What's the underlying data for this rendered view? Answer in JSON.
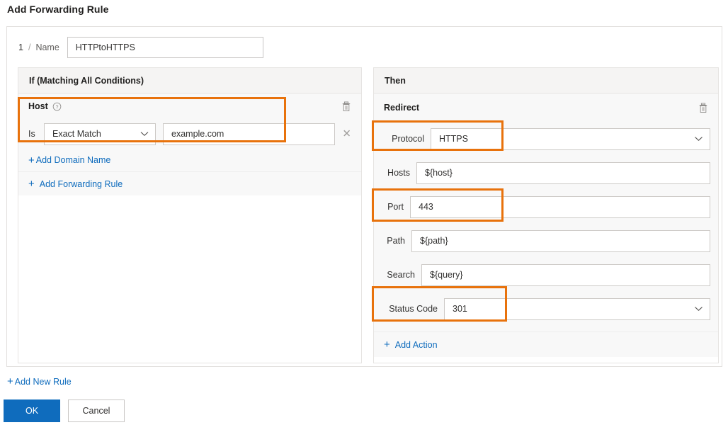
{
  "dialog": {
    "title": "Add Forwarding Rule"
  },
  "rule": {
    "index": "1",
    "separator": "/",
    "name_label": "Name",
    "name_value": "HTTPtoHTTPS",
    "name_placeholder": ""
  },
  "if_panel": {
    "header": "If (Matching All Conditions)",
    "condition": {
      "title": "Host",
      "help_icon": "help-circle-icon",
      "delete_icon": "trash-icon",
      "operator_label": "Is",
      "match_type": "Exact Match",
      "match_chevron": "chevron-down-icon",
      "value": "example.com",
      "value_placeholder": "",
      "clear_icon": "close-icon"
    },
    "add_domain_name": "Add Domain Name",
    "add_forwarding_rule": "Add Forwarding Rule"
  },
  "then_panel": {
    "header": "Then",
    "action": {
      "title": "Redirect",
      "delete_icon": "trash-icon",
      "fields": [
        {
          "label": "Protocol",
          "value": "HTTPS",
          "type": "dropdown",
          "chevron": "chevron-down-icon"
        },
        {
          "label": "Hosts",
          "value": "${host}",
          "type": "text"
        },
        {
          "label": "Port",
          "value": "443",
          "type": "text"
        },
        {
          "label": "Path",
          "value": "${path}",
          "type": "text"
        },
        {
          "label": "Search",
          "value": "${query}",
          "type": "text"
        },
        {
          "label": "Status Code",
          "value": "301",
          "type": "dropdown",
          "chevron": "chevron-down-icon"
        }
      ]
    },
    "add_action": "Add Action"
  },
  "footer": {
    "add_new_rule": "Add New Rule",
    "ok": "OK",
    "cancel": "Cancel"
  },
  "colors": {
    "highlight": "#e8720c",
    "link": "#0f6cbd",
    "primary_button": "#0f6cbd",
    "panel_header_bg": "#f5f4f3",
    "block_bg": "#f8f8f8"
  }
}
